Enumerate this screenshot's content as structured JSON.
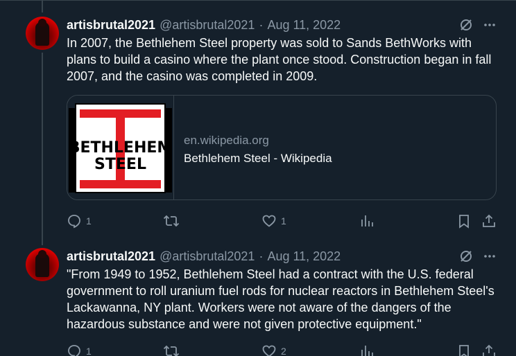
{
  "colors": {
    "background": "#15202b",
    "border": "#38444d",
    "text_primary": "#f7f9f9",
    "text_secondary": "#8b98a5",
    "logo_red": "#e31e24"
  },
  "tweets": [
    {
      "display_name": "artisbrutal2021",
      "handle": "@artisbrutal2021",
      "separator": "·",
      "date": "Aug 11, 2022",
      "text": "In 2007, the Bethlehem Steel property was sold to Sands BethWorks with plans to build a casino where the plant once stood. Construction began in fall 2007, and the casino was completed in 2009.",
      "card": {
        "logo_line1": "BETHLEHEM",
        "logo_line2": "STEEL",
        "domain": "en.wikipedia.org",
        "title": "Bethlehem Steel - Wikipedia"
      },
      "actions": {
        "replies": "1",
        "retweets": "",
        "likes": "1",
        "views": ""
      }
    },
    {
      "display_name": "artisbrutal2021",
      "handle": "@artisbrutal2021",
      "separator": "·",
      "date": "Aug 11, 2022",
      "text": "\"From 1949 to 1952, Bethlehem Steel had a contract with the U.S. federal government to roll uranium fuel rods for nuclear reactors in Bethlehem Steel's Lackawanna, NY plant. Workers were not aware of the dangers of the hazardous substance and were not given protective equipment.\"",
      "actions": {
        "replies": "1",
        "retweets": "",
        "likes": "2",
        "views": ""
      }
    }
  ],
  "icons": {
    "grok": "grok-slash-circle-icon",
    "more": "more-dots-icon",
    "reply": "reply-bubble-icon",
    "retweet": "retweet-icon",
    "like": "heart-icon",
    "views": "views-bars-icon",
    "bookmark": "bookmark-icon",
    "share": "share-upload-icon"
  }
}
